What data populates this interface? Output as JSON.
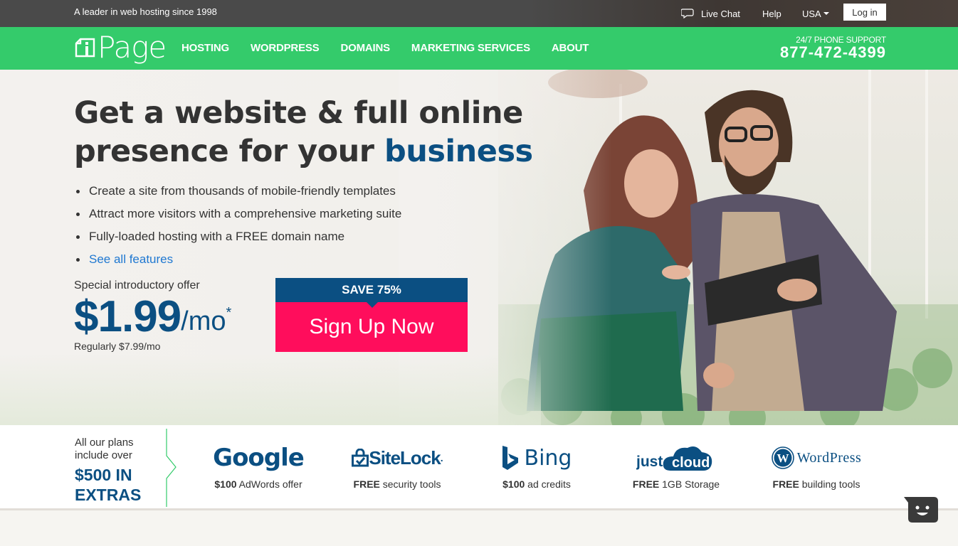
{
  "topbar": {
    "tagline": "A leader in web hosting since 1998",
    "live_chat": "Live Chat",
    "help": "Help",
    "region": "USA",
    "login": "Log in"
  },
  "nav": {
    "logo_text": "iPage",
    "links": [
      "HOSTING",
      "WORDPRESS",
      "DOMAINS",
      "MARKETING SERVICES",
      "ABOUT"
    ],
    "phone_label": "24/7 PHONE SUPPORT",
    "phone_number": "877-472-4399"
  },
  "hero": {
    "headline_line1": "Get a website & full online",
    "headline_line2_prefix": "presence for your ",
    "headline_highlight": "business",
    "bullets": [
      "Create a site from thousands of mobile-friendly templates",
      "Attract more visitors with a comprehensive marketing suite",
      "Fully-loaded hosting with a FREE domain name"
    ],
    "features_link": "See all features",
    "offer_intro": "Special introductory offer",
    "price": "$1.99",
    "price_unit": "/mo",
    "price_asterisk": "*",
    "regular_price": "Regularly $7.99/mo",
    "save_badge": "SAVE 75%",
    "cta": "Sign Up Now"
  },
  "extras": {
    "intro_line1": "All our plans",
    "intro_line2": "include over",
    "headline_line1": "$500 IN",
    "headline_line2": "EXTRAS",
    "partners": [
      {
        "name": "Google",
        "bold": "$100",
        "desc": " AdWords offer"
      },
      {
        "name": "SiteLock",
        "bold": "FREE",
        "desc": " security tools"
      },
      {
        "name": "Bing",
        "bold": "$100",
        "desc": " ad credits"
      },
      {
        "name": "justcloud",
        "bold": "FREE",
        "desc": " 1GB Storage"
      },
      {
        "name": "WordPress",
        "bold": "FREE",
        "desc": " building tools"
      }
    ]
  },
  "colors": {
    "brand_green": "#34cb6b",
    "brand_blue": "#0b4f82",
    "cta_pink": "#ff0d5c",
    "topbar_gray": "#4a4a4a"
  }
}
